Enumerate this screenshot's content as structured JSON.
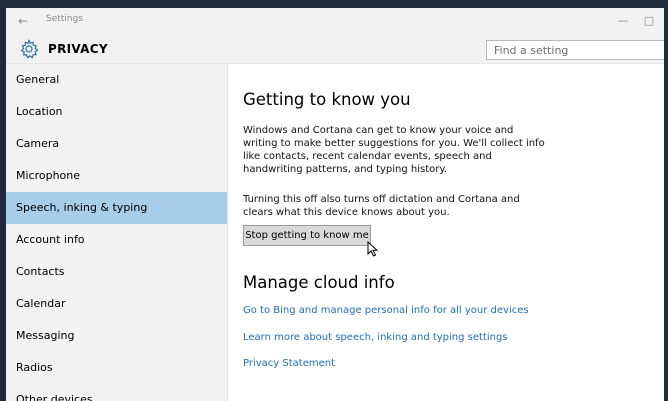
{
  "window": {
    "title": "Settings",
    "back_symbol": "←",
    "minimize_symbol": "—",
    "maximize_symbol": "□"
  },
  "header": {
    "section_title": "PRIVACY",
    "gear_icon": "gear-icon",
    "search_placeholder": "Find a setting"
  },
  "sidebar": {
    "items": [
      {
        "label": "General"
      },
      {
        "label": "Location"
      },
      {
        "label": "Camera"
      },
      {
        "label": "Microphone"
      },
      {
        "label": "Speech, inking & typing",
        "active": true
      },
      {
        "label": "Account info"
      },
      {
        "label": "Contacts"
      },
      {
        "label": "Calendar"
      },
      {
        "label": "Messaging"
      },
      {
        "label": "Radios"
      },
      {
        "label": "Other devices"
      }
    ]
  },
  "main": {
    "heading": "Getting to know you",
    "paragraph1": "Windows and Cortana can get to know your voice and writing to make better suggestions for you. We'll collect info like contacts, recent calendar events, speech and handwriting patterns, and typing history.",
    "paragraph2": "Turning this off also turns off dictation and Cortana and clears what this device knows about you.",
    "button_label": "Stop getting to know me",
    "cloud_heading": "Manage cloud info",
    "links": [
      "Go to Bing and manage personal info for all your devices",
      "Learn more about speech, inking and typing settings",
      "Privacy Statement"
    ]
  },
  "colors": {
    "accent_link": "#1f6fb8",
    "active_nav": "#a7cde9",
    "frame": "#1f2b3a"
  }
}
